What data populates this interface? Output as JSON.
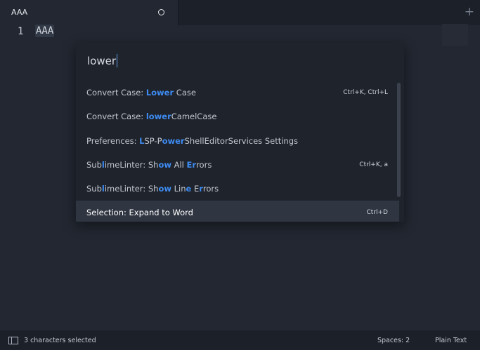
{
  "tab": {
    "title": "AAA",
    "new_tab": "+"
  },
  "editor": {
    "line_number": "1",
    "text": "AAA"
  },
  "palette": {
    "query": "lower",
    "items": [
      {
        "label": "Convert Case: Lower Case",
        "shortcut": "Ctrl+K, Ctrl+L",
        "selected": false
      },
      {
        "label": "Convert Case: lowerCamelCase",
        "shortcut": "",
        "selected": false
      },
      {
        "label": "Preferences: LSP-PowerShellEditorServices Settings",
        "shortcut": "",
        "selected": false
      },
      {
        "label": "SublimeLinter: Show All Errors",
        "shortcut": "Ctrl+K, a",
        "selected": false
      },
      {
        "label": "SublimeLinter: Show Line Errors",
        "shortcut": "",
        "selected": false
      },
      {
        "label": "Selection: Expand to Word",
        "shortcut": "Ctrl+D",
        "selected": true
      }
    ]
  },
  "status": {
    "selection": "3 characters selected",
    "indentation": "Spaces: 2",
    "syntax": "Plain Text"
  },
  "colors": {
    "accent": "#3d8bf2",
    "background": "#222731",
    "panel": "#1f232b"
  },
  "icons": [
    "dirty-indicator-icon",
    "new-tab-icon",
    "panel-toggle-icon"
  ]
}
